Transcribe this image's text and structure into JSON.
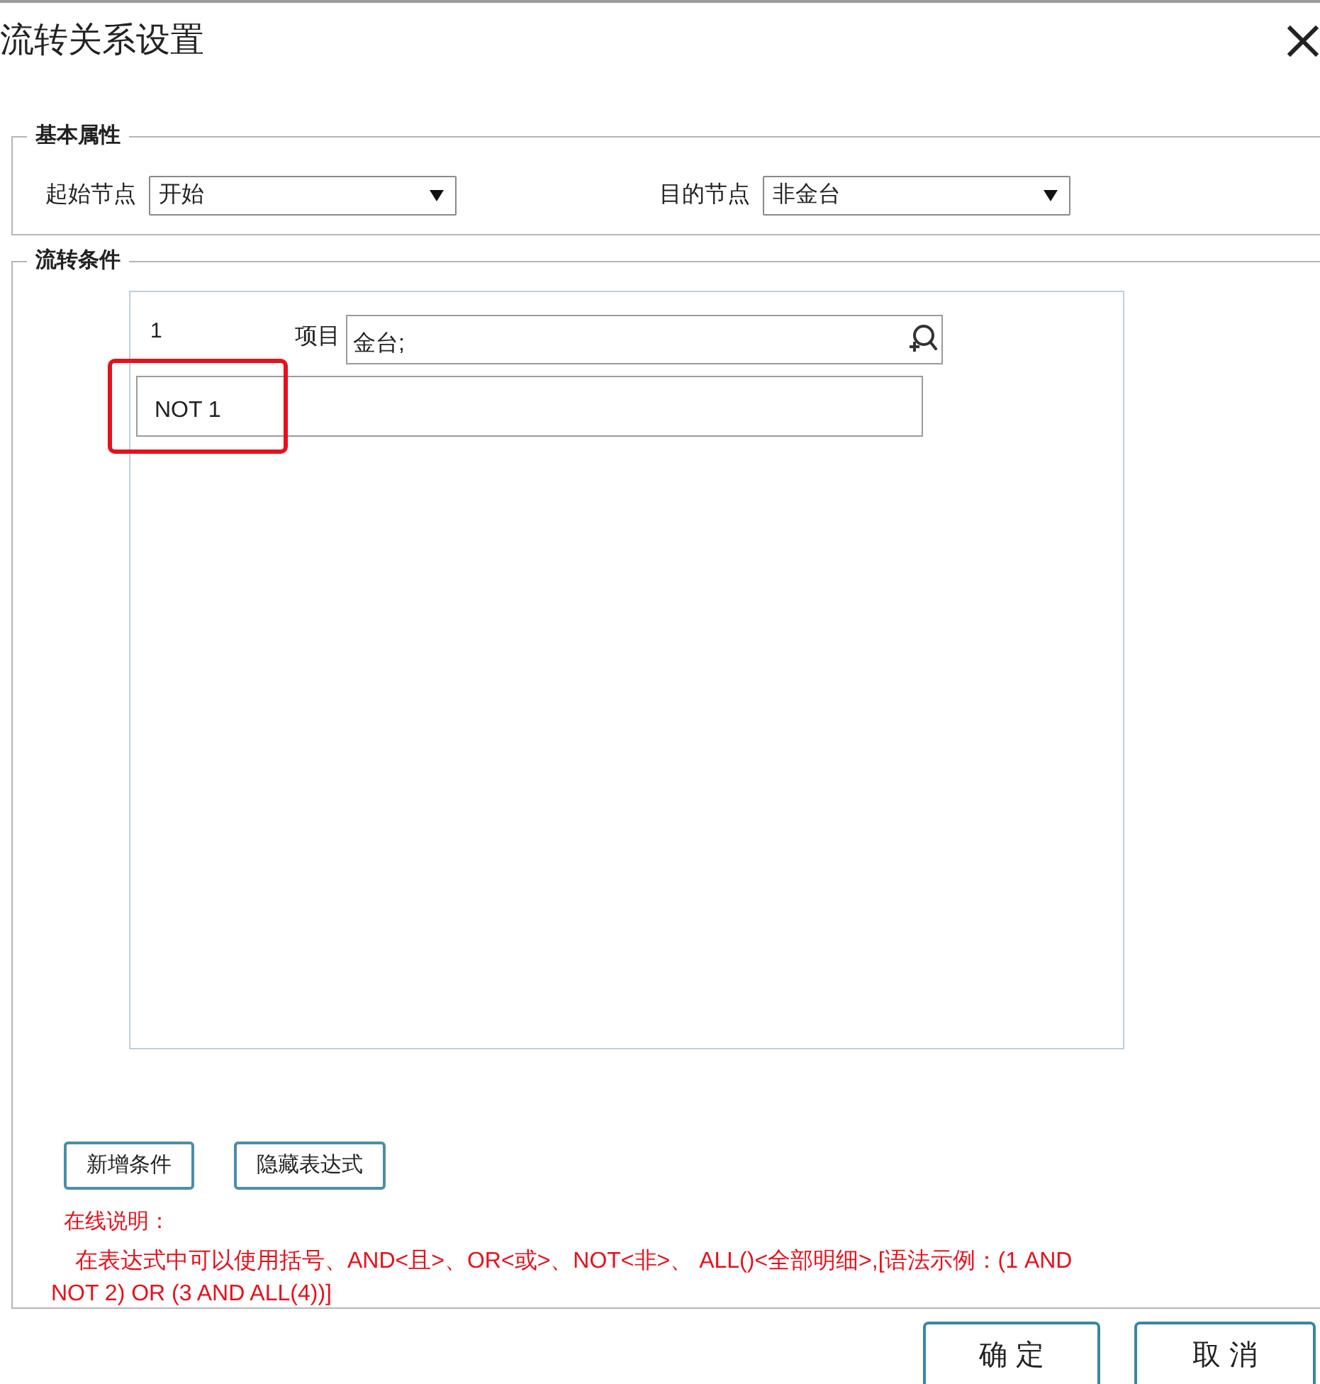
{
  "window": {
    "title": "流转关系设置"
  },
  "basic_properties": {
    "legend": "基本属性",
    "fields": [
      {
        "label": "起始节点",
        "value": "开始"
      },
      {
        "label": "目的节点",
        "value": "非金台"
      }
    ]
  },
  "conditions": {
    "legend": "流转条件",
    "items": [
      {
        "number": "1",
        "label": "项目",
        "value": "金台;"
      }
    ],
    "expression": {
      "value": "NOT 1",
      "highlighted": true
    }
  },
  "buttons": [
    "新增条件",
    "隐藏表达式"
  ],
  "help": {
    "title": "在线说明：",
    "text": "在表达式中可以使用括号、AND<且>、OR<或>、NOT<非>、 ALL()<全部明细>,[语法示例：(1 AND NOT 2) OR (3 AND ALL(4))]"
  },
  "dialog_buttons": [
    "确 定",
    "取 消"
  ]
}
